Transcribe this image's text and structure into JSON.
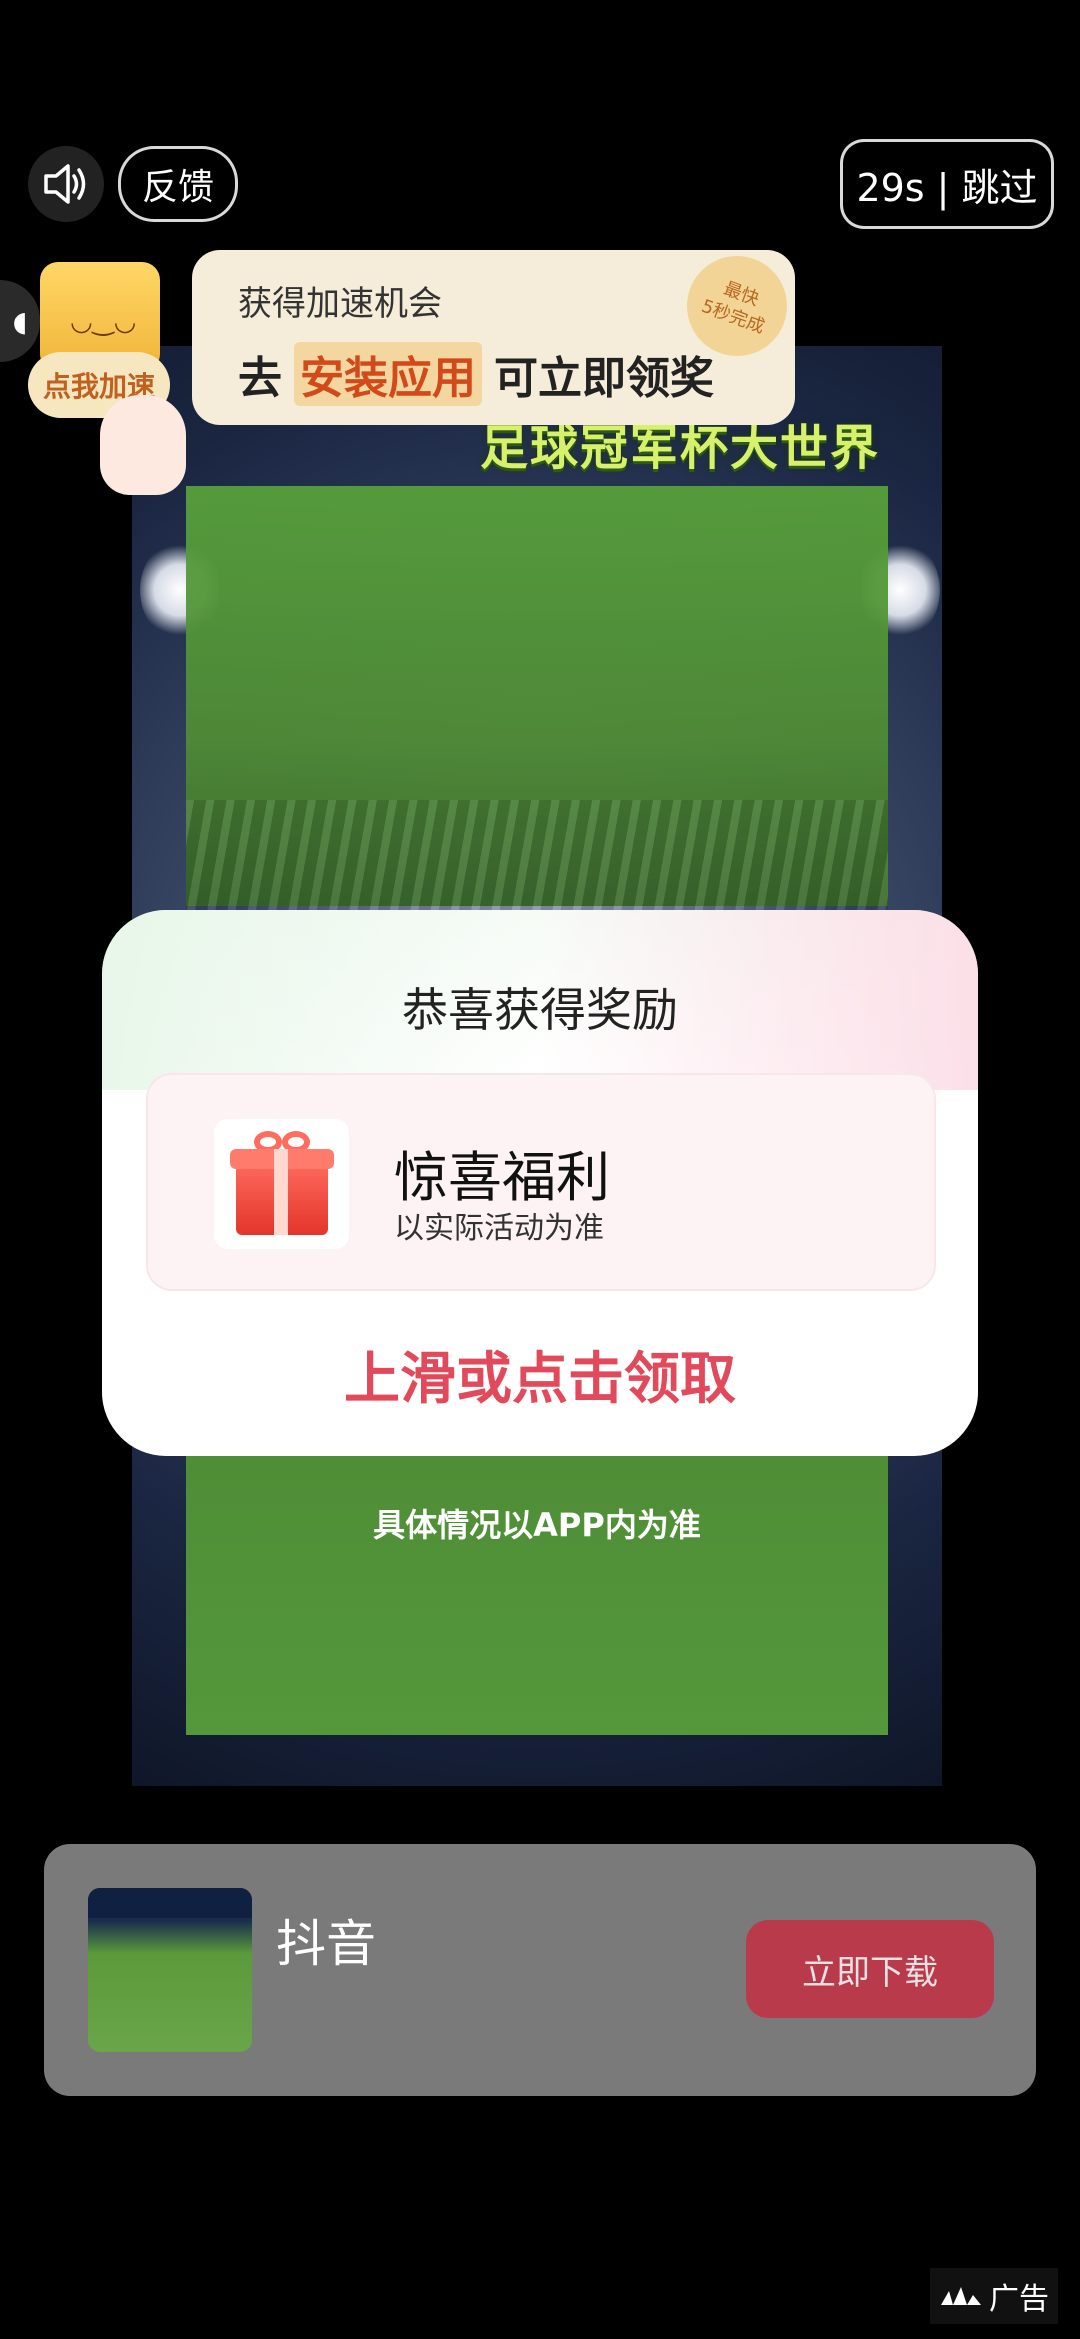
{
  "top_bar": {
    "feedback_label": "反馈",
    "skip_label": "29s | 跳过",
    "sound_icon": "speaker-icon"
  },
  "speed_widget": {
    "label": "点我加速"
  },
  "promo_banner": {
    "line1": "获得加速机会",
    "line2_prefix": "去",
    "line2_highlight": "安装应用",
    "line2_suffix": "可立即领奖",
    "badge_line1": "最快",
    "badge_line2": "5秒完成"
  },
  "video": {
    "title": "足球冠军杯大世界",
    "caption": "具体情况以APP内为准"
  },
  "reward_modal": {
    "title": "恭喜获得奖励",
    "reward_name": "惊喜福利",
    "reward_sub": "以实际活动为准",
    "claim_text": "上滑或点击领取"
  },
  "app_card": {
    "app_name": "抖音",
    "download_label": "立即下载"
  },
  "ad_badge": {
    "label": "广告"
  },
  "colors": {
    "claim_red": "#e24a5b",
    "download_button": "#b83a4b",
    "promo_highlight": "#d24a1a"
  }
}
